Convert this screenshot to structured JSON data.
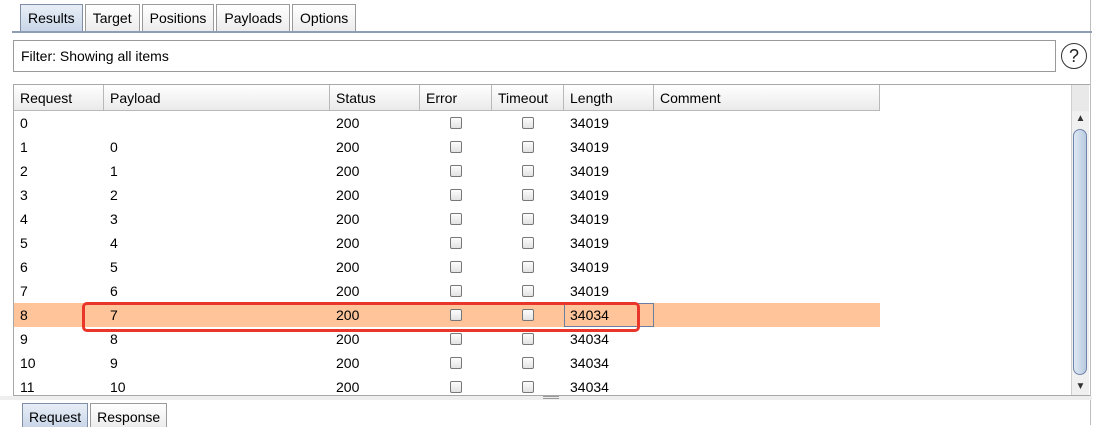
{
  "tabs": [
    "Results",
    "Target",
    "Positions",
    "Payloads",
    "Options"
  ],
  "filter": {
    "text": "Filter: Showing all items"
  },
  "help_glyph": "?",
  "table": {
    "columns": [
      "Request",
      "Payload",
      "Status",
      "Error",
      "Timeout",
      "Length",
      "Comment"
    ],
    "rows": [
      {
        "request": "0",
        "payload": "",
        "status": "200",
        "error": false,
        "timeout": false,
        "length": "34019",
        "comment": ""
      },
      {
        "request": "1",
        "payload": "0",
        "status": "200",
        "error": false,
        "timeout": false,
        "length": "34019",
        "comment": ""
      },
      {
        "request": "2",
        "payload": "1",
        "status": "200",
        "error": false,
        "timeout": false,
        "length": "34019",
        "comment": ""
      },
      {
        "request": "3",
        "payload": "2",
        "status": "200",
        "error": false,
        "timeout": false,
        "length": "34019",
        "comment": ""
      },
      {
        "request": "4",
        "payload": "3",
        "status": "200",
        "error": false,
        "timeout": false,
        "length": "34019",
        "comment": ""
      },
      {
        "request": "5",
        "payload": "4",
        "status": "200",
        "error": false,
        "timeout": false,
        "length": "34019",
        "comment": ""
      },
      {
        "request": "6",
        "payload": "5",
        "status": "200",
        "error": false,
        "timeout": false,
        "length": "34019",
        "comment": ""
      },
      {
        "request": "7",
        "payload": "6",
        "status": "200",
        "error": false,
        "timeout": false,
        "length": "34019",
        "comment": ""
      },
      {
        "request": "8",
        "payload": "7",
        "status": "200",
        "error": false,
        "timeout": false,
        "length": "34034",
        "comment": "",
        "selected": true
      },
      {
        "request": "9",
        "payload": "8",
        "status": "200",
        "error": false,
        "timeout": false,
        "length": "34034",
        "comment": ""
      },
      {
        "request": "10",
        "payload": "9",
        "status": "200",
        "error": false,
        "timeout": false,
        "length": "34034",
        "comment": ""
      },
      {
        "request": "11",
        "payload": "10",
        "status": "200",
        "error": false,
        "timeout": false,
        "length": "34034",
        "comment": ""
      }
    ]
  },
  "bottom_tabs": [
    "Request",
    "Response"
  ],
  "colors": {
    "selected_row": "#ffc49a",
    "highlight_box": "#e8362b",
    "active_tab": "#c9d6e8"
  }
}
